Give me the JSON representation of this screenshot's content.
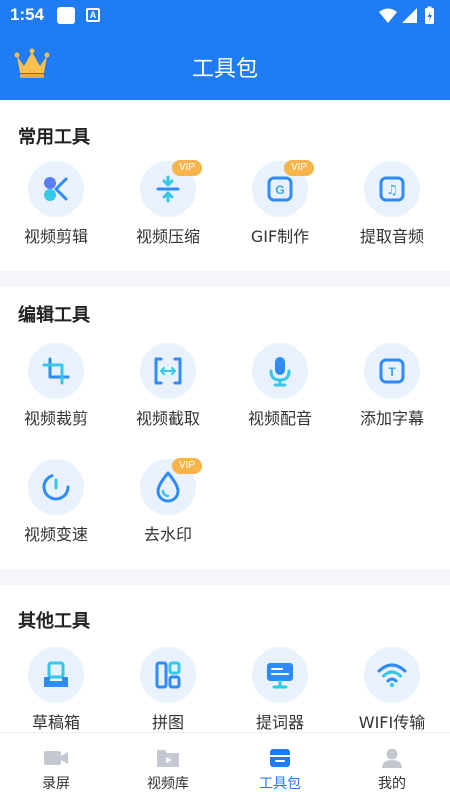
{
  "status_bar": {
    "time": "1:54",
    "a_badge": "A"
  },
  "header": {
    "title": "工具包"
  },
  "sections": [
    {
      "title": "常用工具",
      "tools": [
        {
          "label": "视频剪辑",
          "icon": "scissors-icon",
          "vip": ""
        },
        {
          "label": "视频压缩",
          "icon": "compress-icon",
          "vip": "VIP"
        },
        {
          "label": "GIF制作",
          "icon": "gif-icon",
          "vip": "VIP",
          "glyph": "G"
        },
        {
          "label": "提取音频",
          "icon": "music-note-icon",
          "vip": "",
          "glyph": "♫"
        }
      ]
    },
    {
      "title": "编辑工具",
      "tools": [
        {
          "label": "视频裁剪",
          "icon": "crop-icon",
          "vip": ""
        },
        {
          "label": "视频截取",
          "icon": "trim-icon",
          "vip": ""
        },
        {
          "label": "视频配音",
          "icon": "microphone-icon",
          "vip": ""
        },
        {
          "label": "添加字幕",
          "icon": "subtitle-icon",
          "vip": "",
          "glyph": "T"
        },
        {
          "label": "视频变速",
          "icon": "speed-gauge-icon",
          "vip": ""
        },
        {
          "label": "去水印",
          "icon": "water-drop-icon",
          "vip": "VIP"
        }
      ]
    },
    {
      "title": "其他工具",
      "tools": [
        {
          "label": "草稿箱",
          "icon": "drafts-box-icon",
          "vip": ""
        },
        {
          "label": "拼图",
          "icon": "collage-icon",
          "vip": ""
        },
        {
          "label": "提词器",
          "icon": "teleprompter-icon",
          "vip": ""
        },
        {
          "label": "WIFI传输",
          "icon": "wifi-icon",
          "vip": ""
        }
      ]
    }
  ],
  "tabbar": [
    {
      "label": "录屏",
      "icon": "video-camera-icon",
      "active": false
    },
    {
      "label": "视频库",
      "icon": "video-folder-icon",
      "active": false
    },
    {
      "label": "工具包",
      "icon": "toolbox-icon",
      "active": true
    },
    {
      "label": "我的",
      "icon": "profile-icon",
      "active": false
    }
  ],
  "colors": {
    "brand": "#1f7cf2",
    "vip": "#f7b44d",
    "icon_bg": "#e9f1fd",
    "icon_primary": "#2f8cf7",
    "icon_accent": "#35c8e8",
    "inactive_tab": "#c4c8d0"
  }
}
